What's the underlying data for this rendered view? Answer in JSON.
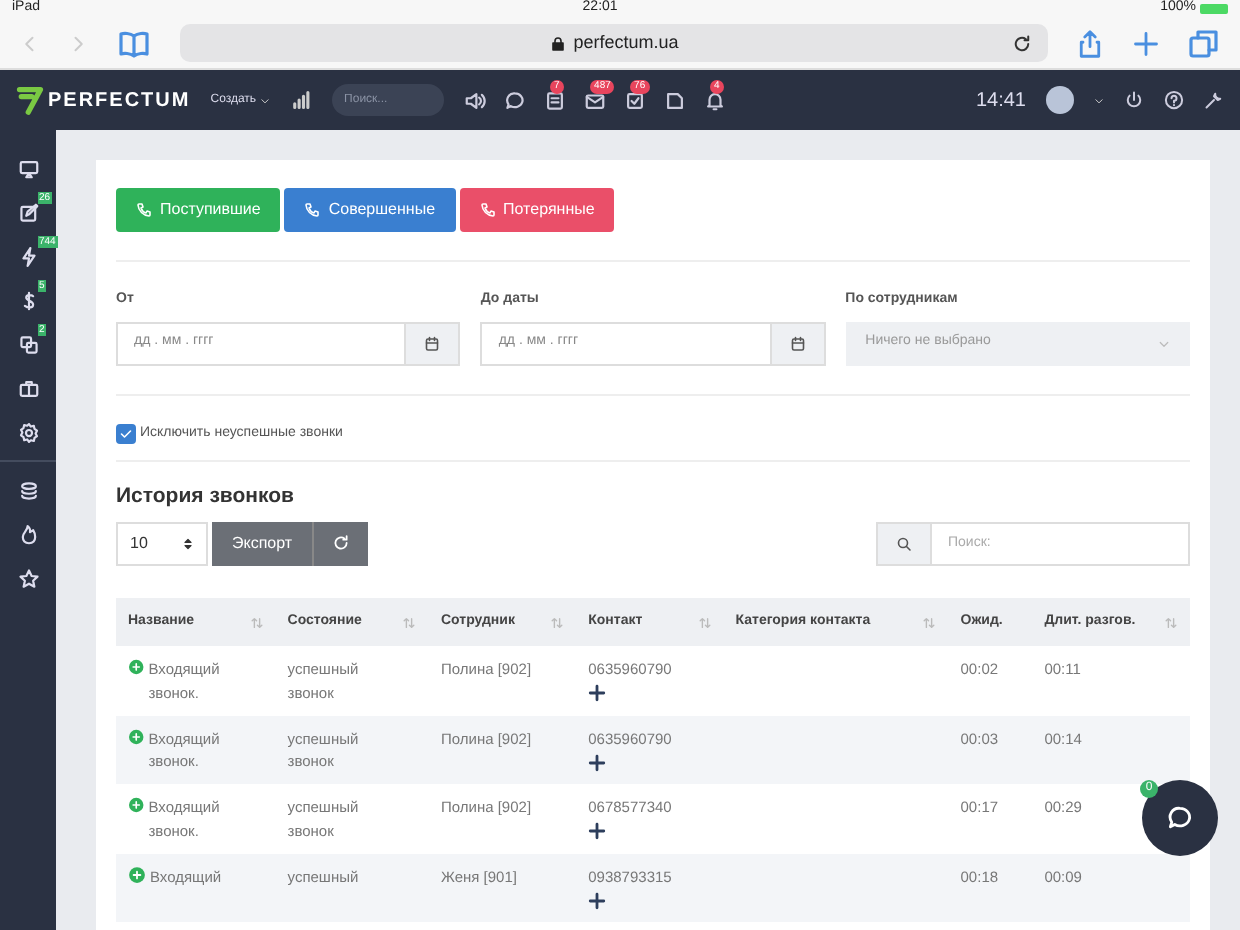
{
  "device_status": {
    "device": "iPad",
    "time": "22:01",
    "battery": "100%"
  },
  "browser": {
    "url": "perfectum.ua"
  },
  "navbar": {
    "brand": "PERFECTUM",
    "create_menu": "Создать",
    "search_placeholder": "Поиск...",
    "icons": [
      {
        "kind": "sound"
      },
      {
        "kind": "chat"
      },
      {
        "kind": "tasks",
        "badge": "7"
      },
      {
        "kind": "mail",
        "badge": "487"
      },
      {
        "kind": "check",
        "badge": "76"
      },
      {
        "kind": "doc"
      },
      {
        "kind": "bell",
        "badge": "4"
      }
    ],
    "time": "14:41"
  },
  "sidebar": {
    "items": [
      {
        "kind": "monitor"
      },
      {
        "kind": "edit",
        "badge": "26"
      },
      {
        "kind": "bolt",
        "badge": "744"
      },
      {
        "kind": "dollar",
        "badge": "5"
      },
      {
        "kind": "copy",
        "badge": "2"
      },
      {
        "kind": "briefcase"
      },
      {
        "kind": "gear"
      },
      {
        "kind": "layers"
      },
      {
        "kind": "fire"
      },
      {
        "kind": "star"
      }
    ]
  },
  "call_type_buttons": [
    {
      "label": "Поступившие",
      "kind": "success"
    },
    {
      "label": "Совершенные",
      "kind": "primary"
    },
    {
      "label": "Потерянные",
      "kind": "danger"
    }
  ],
  "filters": {
    "from": {
      "label": "От",
      "placeholder": "дд . мм . гггг"
    },
    "to": {
      "label": "До даты",
      "placeholder": "дд . мм . гггг"
    },
    "employees": {
      "label": "По сотрудникам",
      "value": "Ничего не выбрано"
    }
  },
  "exclude_failed": {
    "label": "Исключить неуспешные звонки",
    "checked": true
  },
  "section_title": "История звонков",
  "toolbar": {
    "page_size": "10",
    "export": "Экспорт",
    "search_placeholder": "Поиск:"
  },
  "table": {
    "columns": [
      {
        "label": "Название",
        "sortable": true
      },
      {
        "label": "Состояние",
        "sortable": true
      },
      {
        "label": "Сотрудник",
        "sortable": true
      },
      {
        "label": "Контакт",
        "sortable": true
      },
      {
        "label": "Категория контакта",
        "sortable": true
      },
      {
        "label": "Ожид.",
        "sortable": false
      },
      {
        "label": "Длит. разгов.",
        "sortable": true
      }
    ],
    "rows": [
      {
        "name": "Входящий звонок.",
        "state": "успешный звонок",
        "employee": "Полина [902]",
        "contact": "0635960790",
        "category": "",
        "wait": "00:02",
        "duration": "00:11"
      },
      {
        "name": "Входящий звонок.",
        "state": "успешный звонок",
        "employee": "Полина [902]",
        "contact": "0635960790",
        "category": "",
        "wait": "00:03",
        "duration": "00:14"
      },
      {
        "name": "Входящий звонок.",
        "state": "успешный звонок",
        "employee": "Полина [902]",
        "contact": "0678577340",
        "category": "",
        "wait": "00:17",
        "duration": "00:29"
      },
      {
        "name": "Входящий",
        "state": "успешный",
        "employee": "Женя [901]",
        "contact": "0938793315",
        "category": "",
        "wait": "00:18",
        "duration": "00:09"
      }
    ]
  },
  "chat_button": {
    "badge": "0"
  }
}
